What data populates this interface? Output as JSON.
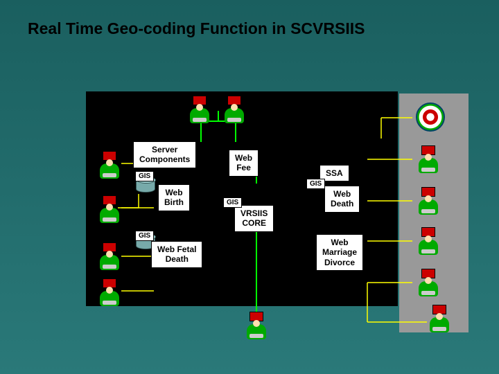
{
  "title": "Real Time Geo-coding Function in SCVRSIIS",
  "labels": {
    "server_components": "Server\nComponents",
    "web_fee": "Web\nFee",
    "ssa": "SSA",
    "web_birth": "Web\nBirth",
    "web_death": "Web\nDeath",
    "vrsiis_core": "VRSIIS\nCORE",
    "web_fetal_death": "Web Fetal\nDeath",
    "web_marriage_divorce": "Web\nMarriage\nDivorce",
    "gis": "GIS"
  }
}
